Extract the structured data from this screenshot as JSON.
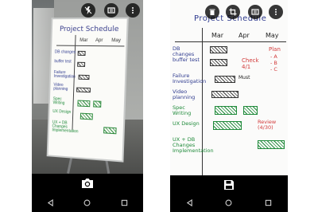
{
  "camera": {
    "board": {
      "title": "Project Schedule",
      "months": [
        "Mar",
        "Apr",
        "May"
      ],
      "tasks": [
        {
          "label": "DB changes",
          "color": "#2f3b8f"
        },
        {
          "label": "buffer test",
          "color": "#2f3b8f"
        },
        {
          "label": "Failure Investigation",
          "color": "#2f3b8f"
        },
        {
          "label": "Video planning",
          "color": "#2f3b8f"
        },
        {
          "label": "Spec Writing",
          "color": "#1f8a3a"
        },
        {
          "label": "UX Design",
          "color": "#1f8a3a"
        },
        {
          "label": "UX + DB Changes Implementation",
          "color": "#1f8a3a"
        }
      ]
    },
    "icons": {
      "top": [
        "flash-off-icon",
        "document-mode-icon",
        "more-options-icon"
      ],
      "shutter": "camera-icon"
    }
  },
  "document": {
    "title": "Project Schedule",
    "months": [
      "Mar",
      "Apr",
      "May"
    ],
    "tasks": [
      {
        "label": "DB changes",
        "style": "blue"
      },
      {
        "label": "buffer test",
        "style": "blue"
      },
      {
        "label": "Failure Investigation",
        "style": "blue"
      },
      {
        "label": "Video planning",
        "style": "blue"
      },
      {
        "label": "Spec Writing",
        "style": "green"
      },
      {
        "label": "UX Design",
        "style": "green"
      },
      {
        "label": "UX + DB Changes Implementation",
        "style": "green"
      }
    ],
    "notes": {
      "must": "Must",
      "check": "Check 4/1",
      "plan_title": "Plan",
      "plan_items": [
        "- A",
        "- B",
        "- C"
      ],
      "review": "Review (4/30)"
    },
    "icons": {
      "top": [
        "delete-icon",
        "crop-icon",
        "document-mode-icon",
        "more-options-icon"
      ],
      "bottom": "save-icon"
    },
    "colors": {
      "blue_ink": "#2f3b8f",
      "green_ink": "#1f8a3a",
      "red_ink": "#d23a3a"
    }
  },
  "navigation": {
    "buttons": [
      "back-icon",
      "home-icon",
      "recents-icon"
    ]
  }
}
